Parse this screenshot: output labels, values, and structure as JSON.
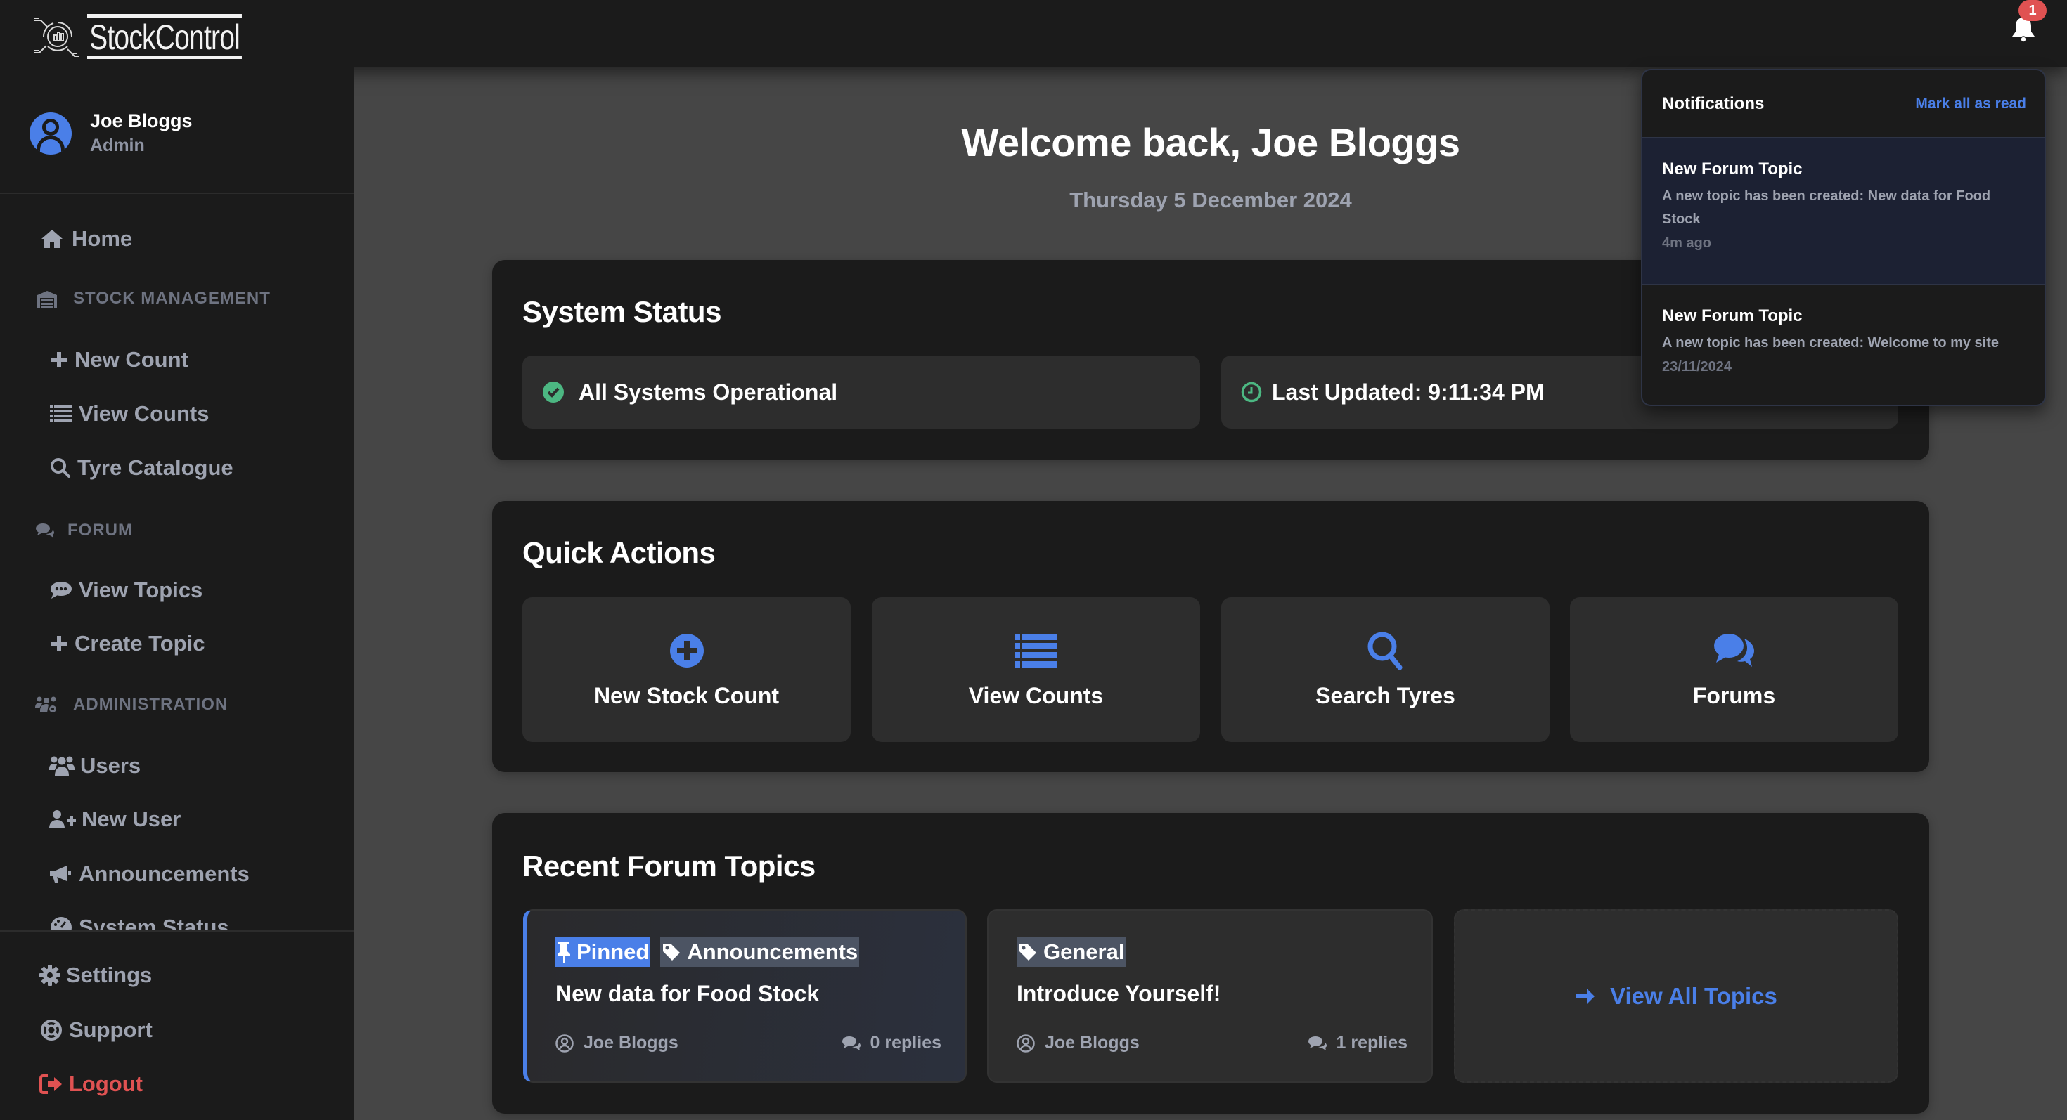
{
  "app": {
    "name": "StockControl"
  },
  "user": {
    "name": "Joe Bloggs",
    "role": "Admin"
  },
  "sidebar": {
    "home": {
      "label": "Home",
      "icon": "home-icon"
    },
    "sections": [
      {
        "label": "STOCK MANAGEMENT",
        "icon": "warehouse-icon",
        "items": [
          {
            "label": "New Count",
            "icon": "plus-icon"
          },
          {
            "label": "View Counts",
            "icon": "list-icon"
          },
          {
            "label": "Tyre Catalogue",
            "icon": "search-icon"
          }
        ]
      },
      {
        "label": "FORUM",
        "icon": "comments-icon",
        "items": [
          {
            "label": "View Topics",
            "icon": "comment-dots-icon"
          },
          {
            "label": "Create Topic",
            "icon": "plus-icon"
          }
        ]
      },
      {
        "label": "ADMINISTRATION",
        "icon": "users-cog-icon",
        "items": [
          {
            "label": "Users",
            "icon": "users-icon"
          },
          {
            "label": "New User",
            "icon": "user-plus-icon"
          },
          {
            "label": "Announcements",
            "icon": "bullhorn-icon"
          },
          {
            "label": "System Status",
            "icon": "gauge-icon"
          }
        ]
      }
    ],
    "footer": [
      {
        "label": "Settings",
        "icon": "gear-icon"
      },
      {
        "label": "Support",
        "icon": "life-ring-icon"
      },
      {
        "label": "Logout",
        "icon": "logout-icon"
      }
    ]
  },
  "header": {
    "notification_count": "1"
  },
  "main": {
    "welcome": "Welcome back, Joe Bloggs",
    "date": "Thursday 5 December 2024",
    "system_status": {
      "title": "System Status",
      "status_text": "All Systems Operational",
      "last_updated": "Last Updated: 9:11:34 PM"
    },
    "quick_actions": {
      "title": "Quick Actions",
      "items": [
        {
          "label": "New Stock Count",
          "icon": "plus-circle-icon"
        },
        {
          "label": "View Counts",
          "icon": "list-icon"
        },
        {
          "label": "Search Tyres",
          "icon": "search-icon"
        },
        {
          "label": "Forums",
          "icon": "comments-icon"
        }
      ]
    },
    "recent_topics": {
      "title": "Recent Forum Topics",
      "topics": [
        {
          "pinned_label": "Pinned",
          "category": "Announcements",
          "title": "New data for Food Stock",
          "author": "Joe Bloggs",
          "replies": "0 replies"
        },
        {
          "category": "General",
          "title": "Introduce Yourself!",
          "author": "Joe Bloggs",
          "replies": "1 replies"
        }
      ],
      "view_all": "View All Topics"
    }
  },
  "notifications": {
    "title": "Notifications",
    "mark_all": "Mark all as read",
    "items": [
      {
        "title": "New Forum Topic",
        "body": "A new topic has been created: New data for Food Stock",
        "time": "4m ago",
        "unread": true
      },
      {
        "title": "New Forum Topic",
        "body": "A new topic has been created: Welcome to my site",
        "time": "23/11/2024",
        "unread": false
      }
    ]
  },
  "colors": {
    "accent": "#4a7fe8",
    "success": "#4cb782",
    "danger": "#e05252",
    "sidebar_bg": "#1b1b1b",
    "main_bg": "#464646"
  }
}
